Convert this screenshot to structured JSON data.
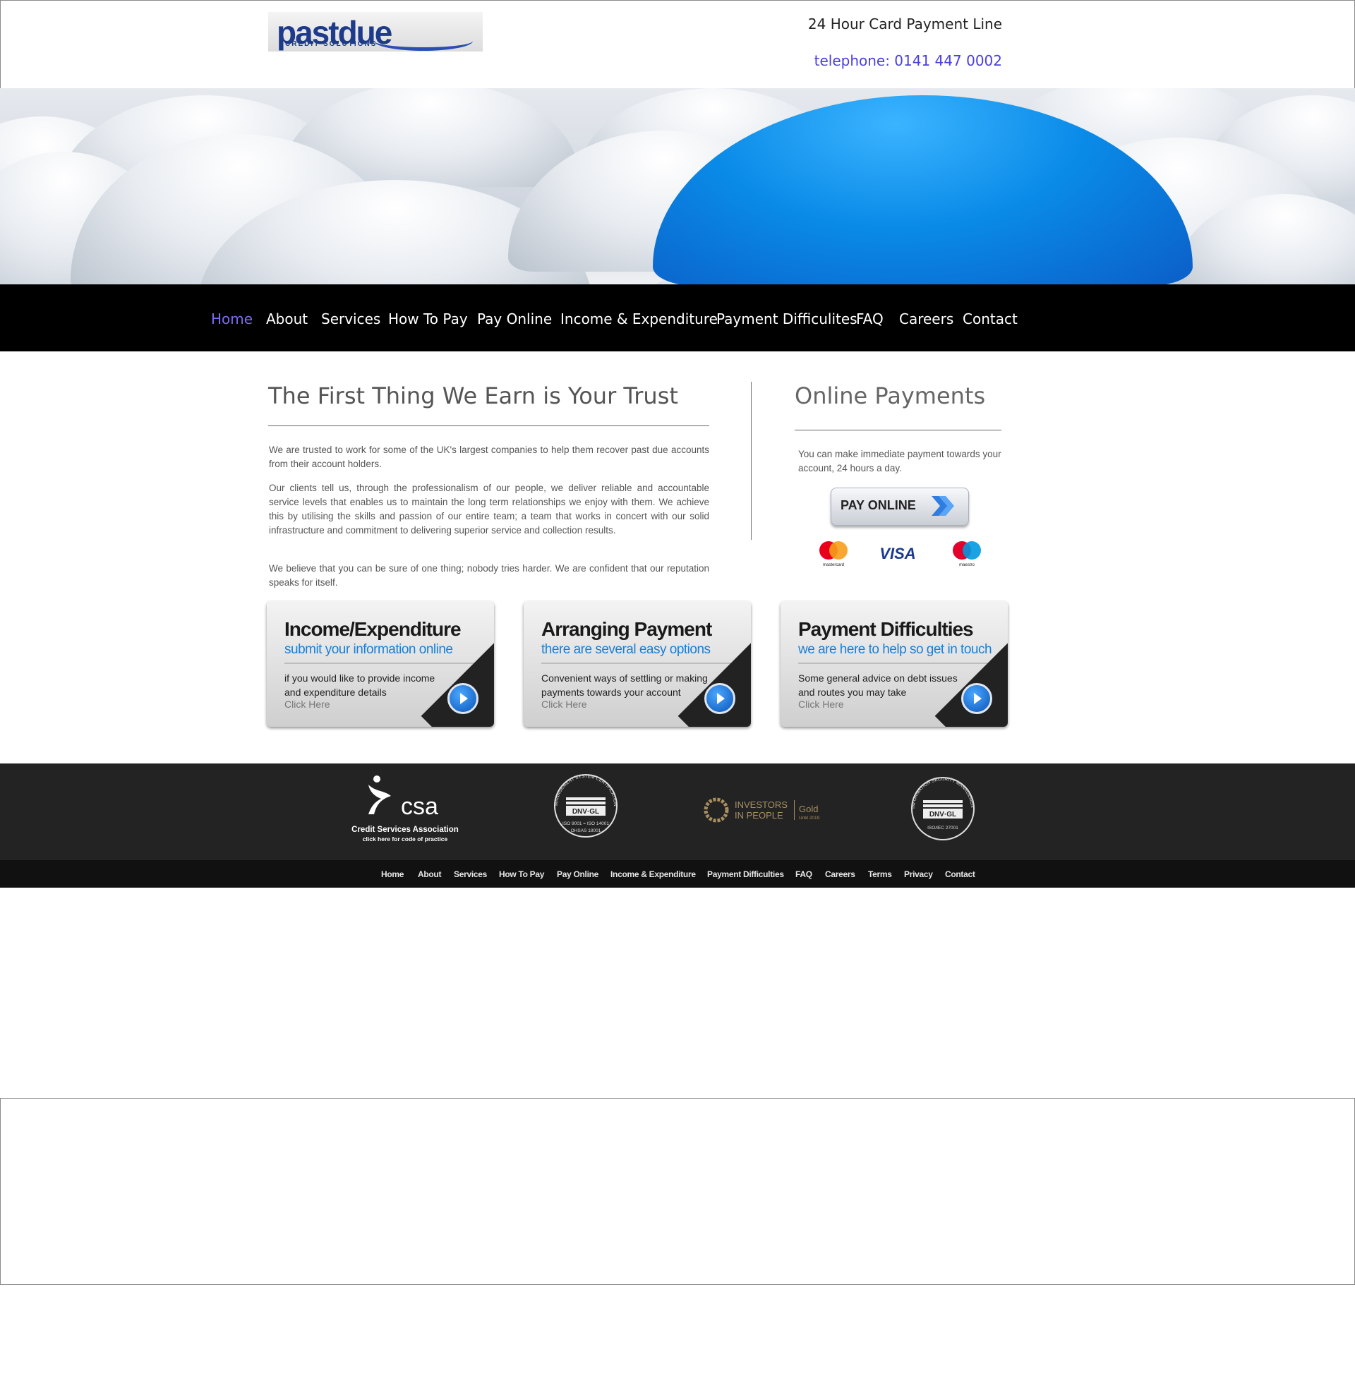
{
  "header": {
    "logo_text": "pastdue",
    "logo_sub": "CREDIT SOLUTIONS",
    "line1": "24 Hour Card Payment Line",
    "line2": "telephone: 0141 447 0002"
  },
  "nav": {
    "items": [
      {
        "label": "Home",
        "active": true
      },
      {
        "label": "About"
      },
      {
        "label": "Services"
      },
      {
        "label": "How To Pay"
      },
      {
        "label": "Pay Online"
      },
      {
        "label": "Income & Expenditure"
      },
      {
        "label": "Payment Difficulites"
      },
      {
        "label": "FAQ"
      },
      {
        "label": "Careers"
      },
      {
        "label": "Contact"
      }
    ],
    "active_color": "#7b6cf0"
  },
  "main": {
    "title": "The First Thing We Earn is Your Trust",
    "paragraphs": [
      "We are trusted to work for some of the UK's largest companies to help them recover past due accounts from their account holders.",
      "Our clients tell us, through the professionalism of our people, we deliver reliable and accountable service levels that enables us to maintain the long term relationships we enjoy with them. We achieve this by utilising the skills and passion of our entire team; a team that works in concert with our solid infrastructure and commitment to delivering superior service and collection results.",
      "We believe that you can be sure of one thing; nobody tries harder. We are confident that our reputation speaks for itself."
    ]
  },
  "payments": {
    "title": "Online Payments",
    "text": "You can make immediate payment towards your account, 24 hours a day.",
    "button_label": "PAY ONLINE",
    "cards": [
      "mastercard",
      "VISA",
      "maestro"
    ]
  },
  "promos": [
    {
      "title": "Income/Expenditure",
      "subtitle": "submit your information online",
      "body": "if you would like to provide income and expenditure details",
      "cta": "Click Here"
    },
    {
      "title": "Arranging Payment",
      "subtitle": "there are several easy options",
      "body": "Convenient ways of settling or making payments towards your account",
      "cta": "Click Here"
    },
    {
      "title": "Payment Difficulties",
      "subtitle": "we are here to help so get in touch",
      "body": "Some general advice on debt issues and routes you may take",
      "cta": "Click Here"
    }
  ],
  "footer": {
    "csa": {
      "name": "csa",
      "line1": "Credit Services Association",
      "line2": "click here for code of practice"
    },
    "dnv1": {
      "top": "MANAGEMENT SYSTEM CERTIFICATION",
      "name": "DNV·GL",
      "line1": "ISO 9001 = ISO 14001",
      "line2": "OHSAS 18001"
    },
    "iip": {
      "line1": "INVESTORS",
      "line2": "IN PEOPLE",
      "level": "Gold",
      "until": "Until 2019"
    },
    "dnv2": {
      "top": "INFORMATION SECURITY MANAGEMENT SYSTEM",
      "name": "DNV·GL",
      "line1": "ISO/IEC 27001"
    },
    "links": [
      "Home",
      "About",
      "Services",
      "How To Pay",
      "Pay Online",
      "Income & Expenditure",
      "Payment Difficulties",
      "FAQ",
      "Careers",
      "Terms",
      "Privacy",
      "Contact"
    ]
  }
}
